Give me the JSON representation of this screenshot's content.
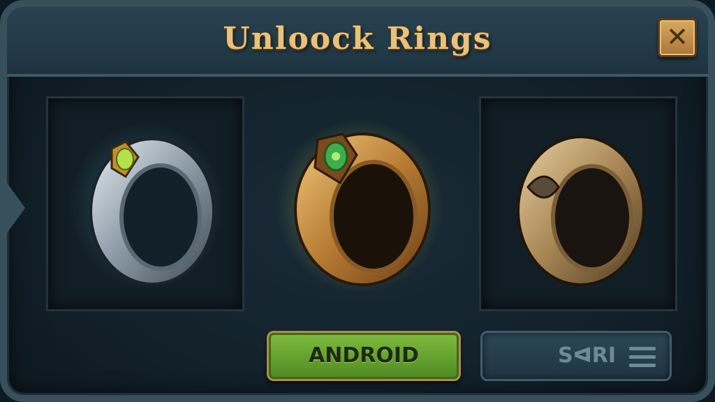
{
  "dialog": {
    "title": "Unloock Rings",
    "close_icon": "close-icon"
  },
  "rings": [
    {
      "name": "silver-ring",
      "gem": "yellow-green gem"
    },
    {
      "name": "gold-ring",
      "gem": "green emerald"
    },
    {
      "name": "bronze-ring",
      "gem": "none"
    }
  ],
  "buttons": {
    "primary_label": "ANDROID",
    "secondary_label": "SᐊRI",
    "secondary_icon": "menu-icon"
  },
  "colors": {
    "title": "#e8c27a",
    "primary_button": "#6aa832",
    "secondary_button": "#28414d",
    "frame": "#38505c"
  }
}
